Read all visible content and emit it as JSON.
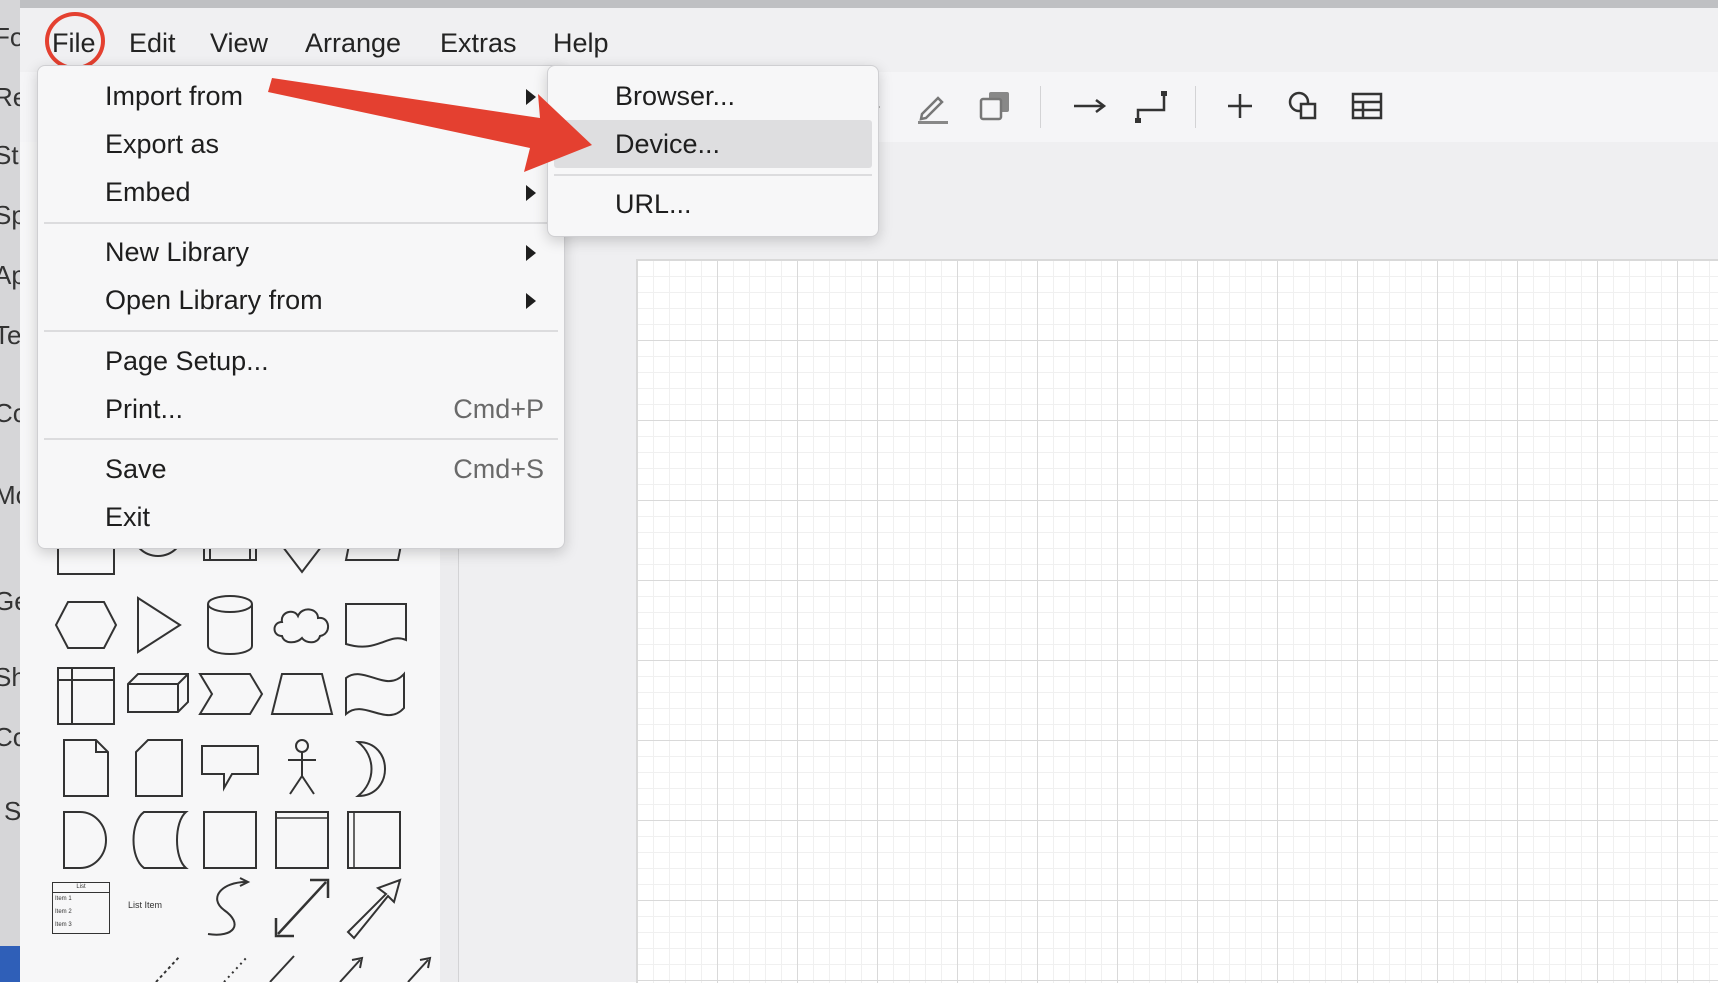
{
  "background_window": {
    "fragments": [
      "Fo",
      "Re",
      "St",
      "Sp",
      "Ap",
      "Te",
      "Co",
      "Mo",
      "Ge",
      "Sh",
      "Co",
      "S"
    ]
  },
  "menubar": {
    "items": [
      {
        "label": "File"
      },
      {
        "label": "Edit"
      },
      {
        "label": "View"
      },
      {
        "label": "Arrange"
      },
      {
        "label": "Extras"
      },
      {
        "label": "Help"
      }
    ]
  },
  "file_menu": {
    "items": [
      {
        "label": "Import from",
        "submenu": true
      },
      {
        "label": "Export as",
        "submenu": true
      },
      {
        "label": "Embed",
        "submenu": true
      },
      {
        "label": "New Library",
        "submenu": true
      },
      {
        "label": "Open Library from",
        "submenu": true
      },
      {
        "label": "Page Setup...",
        "shortcut": ""
      },
      {
        "label": "Print...",
        "shortcut": "Cmd+P"
      },
      {
        "label": "Save",
        "shortcut": "Cmd+S"
      },
      {
        "label": "Exit",
        "shortcut": ""
      }
    ]
  },
  "import_submenu": {
    "items": [
      {
        "label": "Browser..."
      },
      {
        "label": "Device...",
        "highlighted": true
      },
      {
        "label": "URL..."
      }
    ]
  },
  "shapes_panel": {
    "list_shape": {
      "title": "List",
      "rows": [
        "Item 1",
        "Item 2",
        "Item 3"
      ]
    },
    "list_item_label": "List Item"
  },
  "colors": {
    "annotation_red": "#e44030",
    "menu_bg": "#f7f7f8",
    "highlight_bg": "#dedee0"
  }
}
